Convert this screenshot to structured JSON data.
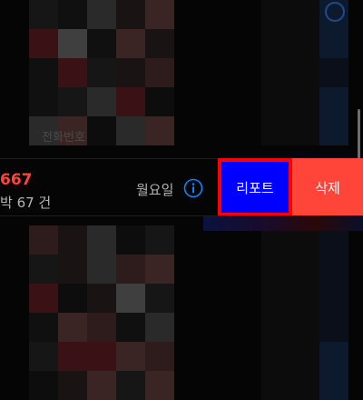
{
  "background_label": "전화번호",
  "row": {
    "number": "667",
    "subtitle": "박 67 건",
    "day": "월요일",
    "info_icon": "info-circle-icon"
  },
  "actions": {
    "report_label": "리포트",
    "delete_label": "삭제"
  },
  "colors": {
    "report_bg": "#0000ff",
    "report_outline": "#ff0000",
    "delete_bg": "#ff453a",
    "number_color": "#ff453a",
    "info_icon_color": "#0a84ff"
  }
}
